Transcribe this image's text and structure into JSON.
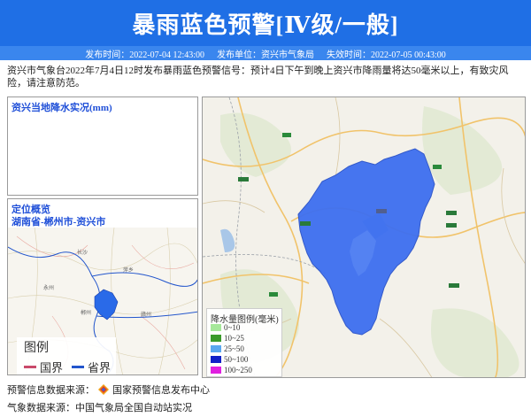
{
  "header": {
    "title": "暴雨蓝色预警[Ⅳ级/一般]"
  },
  "subbar": {
    "publish_time": "发布时间：2022-07-04 12:43:00",
    "publisher": "发布单位：资兴市气象局",
    "expire_time": "失效时间：2022-07-05 00:43:00"
  },
  "description": "资兴市气象台2022年7月4日12时发布暴雨蓝色预警信号：预计4日下午到晚上资兴市降雨量将达50毫米以上，有致灾风险，请注意防范。",
  "rain_panel": {
    "title": "资兴当地降水实况(mm)"
  },
  "location_panel": {
    "title": "定位概览",
    "location": "湖南省-郴州市-资兴市",
    "legend": {
      "title": "图例",
      "items": [
        {
          "label": "国界",
          "color": "#c94a6a"
        },
        {
          "label": "省界",
          "color": "#2255cc"
        }
      ]
    }
  },
  "main_map": {
    "legend": {
      "title": "降水量图例(毫米)",
      "items": [
        {
          "label": "0~10",
          "color": "#a6e89a"
        },
        {
          "label": "10~25",
          "color": "#3a9a2a"
        },
        {
          "label": "25~50",
          "color": "#5aa8f0"
        },
        {
          "label": "50~100",
          "color": "#1020c8"
        },
        {
          "label": "100~250",
          "color": "#e020e0"
        }
      ]
    },
    "region_color": "#3d6ff0"
  },
  "footer": {
    "source1_label": "预警信息数据来源：",
    "source1_value": "国家预警信息发布中心",
    "source2": "气象数据来源：中国气象局全国自动站实况"
  }
}
